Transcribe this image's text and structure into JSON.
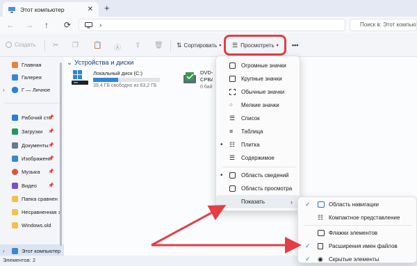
{
  "window": {
    "tab_title": "Этот компьютер",
    "tab_close": "✕",
    "new_tab": "+"
  },
  "address": {
    "back": "←",
    "forward": "→",
    "up": "↑",
    "refresh": "⟳",
    "path_chevron": "›",
    "search_placeholder": "Поиск в: Этот компьютер"
  },
  "toolbar": {
    "create": "Создать",
    "sort": "Сортировать",
    "view": "Просмотреть",
    "more": "•••"
  },
  "sidebar": {
    "items": [
      {
        "label": "Главная",
        "color": "#e8833a"
      },
      {
        "label": "Галерея",
        "color": "#3a87d6"
      },
      {
        "label": "Г — Личное",
        "color": "#2b7fd8"
      },
      {
        "label": "Рабочий сто",
        "color": "#2b7fd8"
      },
      {
        "label": "Загрузки",
        "color": "#1e9a5a"
      },
      {
        "label": "Документы",
        "color": "#6a7890"
      },
      {
        "label": "Изображени",
        "color": "#3a87d6"
      },
      {
        "label": "Музыка",
        "color": "#e2533a"
      },
      {
        "label": "Видео",
        "color": "#7b4fcf"
      },
      {
        "label": "Папка сравнен",
        "color": "#f2c14e"
      },
      {
        "label": "Несравненная з",
        "color": "#f2c14e"
      },
      {
        "label": "Windows.old",
        "color": "#f2c14e"
      },
      {
        "label": "Этот компьютер",
        "color": "#3a87d6"
      }
    ],
    "pin": "📌",
    "expand": "›"
  },
  "main": {
    "group_chevron": "⌄",
    "group_title": "Устройства и диски",
    "drive_name": "Локальный диск (C:)",
    "drive_free": "39,4 ГБ свободно из 63,2 ГБ",
    "drive_used_fraction": 0.38,
    "dvd_name_1": "DVD-",
    "dvd_name_2": "CPBA",
    "dvd_size": "0 бай"
  },
  "menu": {
    "items": [
      {
        "label": "Огромные значки",
        "bullet": ""
      },
      {
        "label": "Крупные значки",
        "bullet": ""
      },
      {
        "label": "Обычные значки",
        "bullet": ""
      },
      {
        "label": "Мелкие значки",
        "bullet": ""
      },
      {
        "label": "Список",
        "bullet": ""
      },
      {
        "label": "Таблица",
        "bullet": ""
      },
      {
        "label": "Плитка",
        "bullet": "•"
      },
      {
        "label": "Содержимое",
        "bullet": ""
      },
      {
        "label": "Область сведений",
        "bullet": "•"
      },
      {
        "label": "Область просмотра",
        "bullet": ""
      }
    ],
    "show": "Показать",
    "show_arrow": "›"
  },
  "submenu": {
    "items": [
      {
        "label": "Область навигации",
        "check": "✓"
      },
      {
        "label": "Компактное представление",
        "check": ""
      },
      {
        "label": "Флажки элементов",
        "check": ""
      },
      {
        "label": "Расширения имен файлов",
        "check": "✓"
      },
      {
        "label": "Скрытые элементы",
        "check": "✓"
      }
    ]
  },
  "status": {
    "text": "Элементов: 2"
  },
  "colors": {
    "highlight": "#e43d45",
    "accent": "#2f86d9"
  }
}
